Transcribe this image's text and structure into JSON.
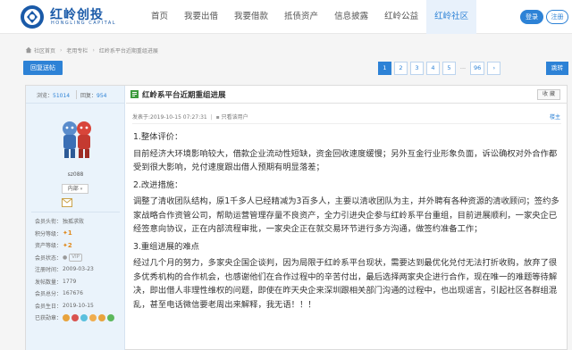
{
  "header": {
    "logo_cn": "红岭创投",
    "logo_en": "HONGLING CAPITAL",
    "nav": [
      "首页",
      "我要出借",
      "我要借款",
      "抵债资产",
      "信息披露",
      "红岭公益",
      "红岭社区"
    ],
    "login": "登录",
    "register": "注册"
  },
  "breadcrumb": [
    "社区首页",
    "老用专栏",
    "红岭系平台近期重组进展"
  ],
  "actions": {
    "back": "回复送帖",
    "pages": [
      "1",
      "2",
      "3",
      "4",
      "5",
      "...",
      "96"
    ],
    "current_page": "1",
    "next": "跳转"
  },
  "user": {
    "views_label": "浏览：",
    "views": "51014",
    "replies_label": "回复：",
    "replies": "954",
    "name": "sz088",
    "badge": "内部",
    "info": [
      {
        "label": "会员头衔：",
        "value": "独孤求败"
      },
      {
        "label": "积分等级：",
        "value": ""
      },
      {
        "label": "资产等级：",
        "value": ""
      },
      {
        "label": "会员状态：",
        "value": "VIP"
      },
      {
        "label": "注册时间：",
        "value": "2009-03-23"
      },
      {
        "label": "发帖数量：",
        "value": "1779"
      },
      {
        "label": "会员总分：",
        "value": "167676"
      },
      {
        "label": "会员生日：",
        "value": "2019-10-15"
      },
      {
        "label": "已获勋章：",
        "value": ""
      }
    ],
    "level1": "1",
    "level2": "2"
  },
  "post": {
    "title": "红岭系平台近期重组进展",
    "collect": "收 藏",
    "meta_date": "发表于:2019-10-15 07:27:31",
    "meta_filter": "只看该用户",
    "floor": "楼主",
    "sections": [
      {
        "heading": "1.整体评价：",
        "body": "目前经济大环境影响较大，借款企业流动性短缺，资金回收速度缓慢；另外互金行业形象负面，诉讼确权对外合作都受到很大影响，兑付速度跟出借人预期有明显落差；"
      },
      {
        "heading": "2.改进措施：",
        "body": "调整了清收团队结构，原1千多人已经精减为3百多人，主要以清收团队为主，并外聘有各种资源的清收顾问；签约多家战略合作资管公司，帮助运营管理存量不良资产，全力引进央企参与红岭系平台重组，目前进展顺利，一家央企已经签意向协议，正在内部流程审批，一家央企正在就交易环节进行多方沟通，做签约准备工作；"
      },
      {
        "heading": "3.重组进展的难点",
        "body": "经过几个月的努力，多家央企国企谈判，因为局限于红岭系平台现状，需要达到最优化兑付无法打折收购，放弃了很多优秀机构的合作机会，也感谢他们在合作过程中的辛苦付出，最后选择两家央企进行合作，现在唯一的难题等待解决，即出借人非理性维权的问题，即使在昨天央企来深圳跟相关部门沟通的过程中，也出现谣言，引起社区各群组混乱，甚至电话微信要老周出来解释，我无语！！！"
      }
    ]
  }
}
